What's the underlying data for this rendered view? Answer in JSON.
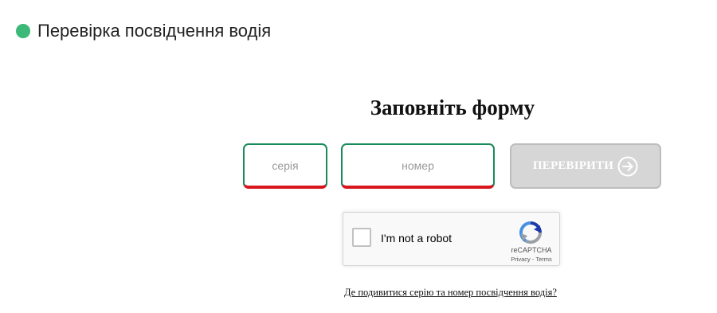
{
  "header": {
    "title": "Перевірка посвідчення водія",
    "status_color": "#3cb878"
  },
  "form": {
    "title": "Заповніть форму",
    "series": {
      "placeholder": "серія",
      "value": ""
    },
    "number": {
      "placeholder": "номер",
      "value": ""
    },
    "check_button": {
      "label": "ПЕРЕВІРИТИ",
      "icon": "arrow-right-circle-icon",
      "state": "disabled"
    }
  },
  "captcha": {
    "label": "I'm not a robot",
    "brand": "reCAPTCHA",
    "privacy": "Privacy",
    "separator": " - ",
    "terms": "Terms",
    "checked": false
  },
  "help": {
    "link_text": "Де подивитися серію та номер посвідчення водія?"
  },
  "colors": {
    "accent_green": "#1b8a5a",
    "error_red": "#d8161d",
    "button_disabled": "#d6d6d6"
  }
}
